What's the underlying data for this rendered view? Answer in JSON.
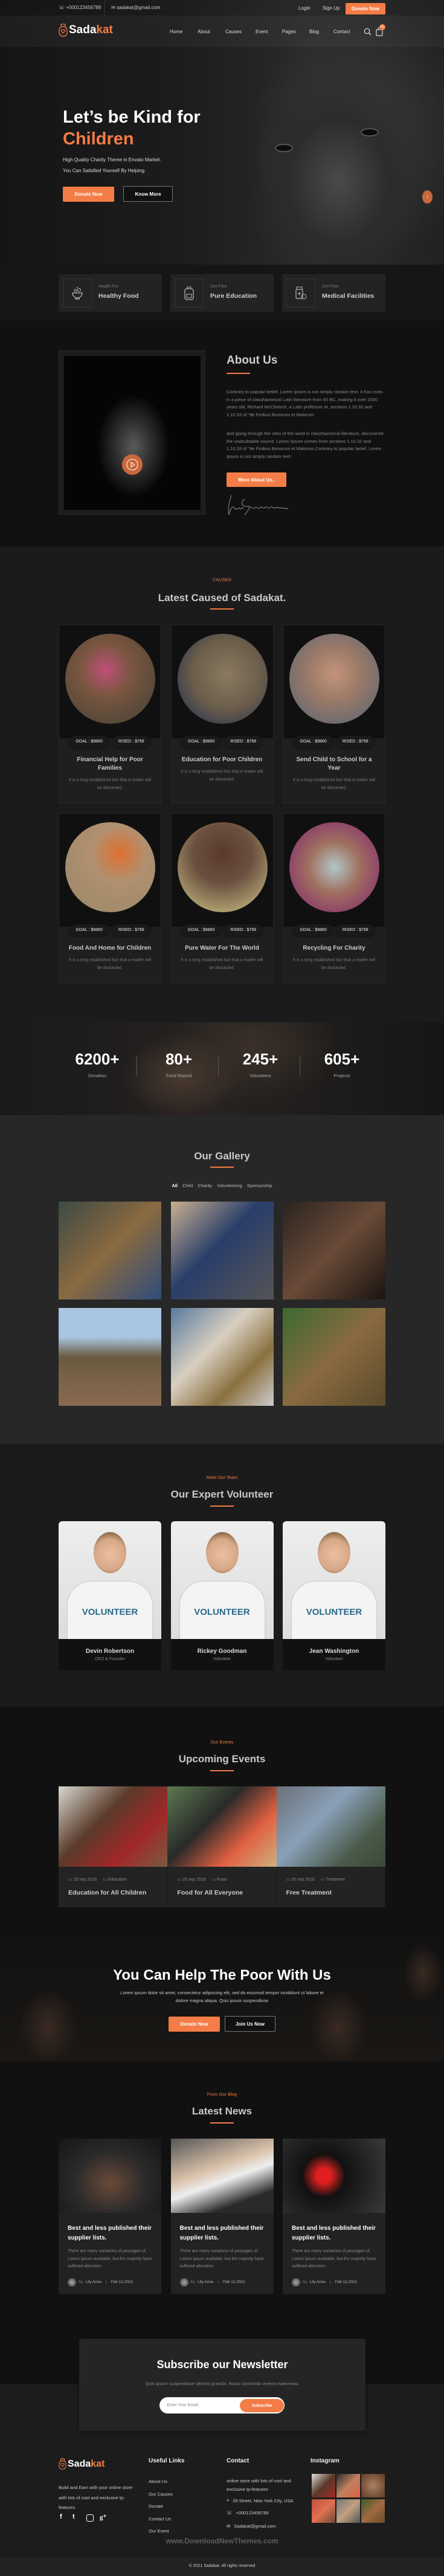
{
  "topbar": {
    "phone": "+000123456789",
    "email": "sadakat@gmail.com",
    "login": "Login",
    "signup": "Sign Up",
    "donate": "Donate Now"
  },
  "brand": {
    "part1": "Sada",
    "part2": "kat",
    "accent": "#f47c46"
  },
  "nav": {
    "items": [
      {
        "label": "Home"
      },
      {
        "label": "About"
      },
      {
        "label": "Causes"
      },
      {
        "label": "Event"
      },
      {
        "label": "Pages"
      },
      {
        "label": "Blog"
      },
      {
        "label": "Contact"
      }
    ],
    "cart_count": "02"
  },
  "hero": {
    "title_line1": "Let’s be Kind for",
    "title_line2": "Children",
    "sub1": "High Quality Charity Theme in Envato Market.",
    "sub2": "You Can Satisfied Yourself By Helping.",
    "donate": "Donate Now",
    "know_more": "Know More"
  },
  "features": [
    {
      "small": "Health For",
      "big": "Healthy Food",
      "icon": "food-bowl-icon"
    },
    {
      "small": "Get Free",
      "big": "Pure Education",
      "icon": "backpack-icon"
    },
    {
      "small": "Get Free",
      "big": "Medical Facilities",
      "icon": "medicine-icon"
    }
  ],
  "about": {
    "title": "About Us",
    "para1": "Contrary to popular belief, Lorem Ipsum is not simply random text. It has roots in a piece of classNameical Latin literature from 45 BC, making it over 2000 years old. Richard McClintock, a Latin professor at ,sections 1.10.32 and 1.10.33 of \"de Finibus Bonorum et Malorum",
    "para2": "and going through the cites of the word in classNameical literature, discovered the undoubtable source. Lorem Ipsum comes from sections 1.10.32 and 1.10.33 of \"de Finibus Bonorum et Malorum,Contrary to popular belief, Lorem Ipsum is not simply random text.",
    "button": "More About Us..",
    "signature": "Frank Sinatra"
  },
  "causes": {
    "kicker": "CAUSES",
    "title": "Latest Caused of Sadakat.",
    "items": [
      {
        "goal": "GOAL : $9860",
        "raised": "RISED : $768",
        "title": "Financial Help for Poor Families",
        "text": "It is a long established fact that a reader will be distracted."
      },
      {
        "goal": "GOAL : $9860",
        "raised": "RISED : $768",
        "title": "Education for Poor Children",
        "text": "It is a long established fact that a reader will be distracted."
      },
      {
        "goal": "GOAL : $9860",
        "raised": "RISED : $768",
        "title": "Send Child to School for a Year",
        "text": "It is a long established fact that a reader will be distracted."
      },
      {
        "goal": "GOAL : $9860",
        "raised": "RISED : $768",
        "title": "Food And Home for Children",
        "text": "It is a long established fact that a reader will be distracted."
      },
      {
        "goal": "GOAL : $9860",
        "raised": "RISED : $768",
        "title": "Pure Water For The World",
        "text": "It is a long established fact that a reader will be distracted."
      },
      {
        "goal": "GOAL : $9860",
        "raised": "RISED : $768",
        "title": "Recycling For Charity",
        "text": "It is a long established fact that a reader will be distracted."
      }
    ]
  },
  "stats": [
    {
      "value": "6200+",
      "label": "Donation"
    },
    {
      "value": "80+",
      "label": "Fund Raised"
    },
    {
      "value": "245+",
      "label": "Volunteers"
    },
    {
      "value": "605+",
      "label": "Projects"
    }
  ],
  "gallery": {
    "title": "Our Gallery",
    "filters": [
      {
        "label": "All"
      },
      {
        "label": "Child"
      },
      {
        "label": "Charity"
      },
      {
        "label": "Volunteering"
      },
      {
        "label": "Sponsorship"
      }
    ],
    "active_filter": "All",
    "images": [
      {},
      {},
      {},
      {},
      {},
      {}
    ]
  },
  "team": {
    "kicker": "Meet Our Team",
    "title": "Our Expert Volunteer",
    "members": [
      {
        "name": "Devin Robertson",
        "role": "CEO & Founder",
        "shirt": "VOLUNTEER"
      },
      {
        "name": "Rickey Goodman",
        "role": "Volunteer",
        "shirt": "VOLUNTEER"
      },
      {
        "name": "Jean Washington",
        "role": "Volunteer",
        "shirt": "VOLUNTEER"
      }
    ]
  },
  "events": {
    "kicker": "Our Events",
    "title": "Upcoming Events",
    "items": [
      {
        "date": "20 sep 2018",
        "category": "Education",
        "title": "Education for All Children"
      },
      {
        "date": "20 sep 2018",
        "category": "Food",
        "title": "Food for All Everyone"
      },
      {
        "date": "20 sep 2018",
        "category": "Treatment",
        "title": "Free Treatment"
      }
    ]
  },
  "cta": {
    "title": "You Can Help The Poor With Us",
    "text": "Lorem ipsum dolor sit amet, consectetur adipiscing elit, sed do eiusmod tempor incididunt ut labore et dolore magna aliqua. Quis ipsum suspendisse",
    "donate": "Donate Now",
    "join": "Join Us Now"
  },
  "blog": {
    "kicker": "From Our Blog",
    "title": "Latest News",
    "posts": [
      {
        "title": "Best and less published their supplier lists.",
        "text": "There are many variations of passages of Lorem Ipsum available, but the majority have suffered alteration.",
        "by": "By",
        "author": "Lily Anne",
        "date": "Feb 12,2021"
      },
      {
        "title": "Best and less published their supplier lists.",
        "text": "There are many variations of passages of Lorem Ipsum available, but the majority have suffered alteration.",
        "by": "By",
        "author": "Lily Anne",
        "date": "Feb 12,2021"
      },
      {
        "title": "Best and less published their supplier lists.",
        "text": "There are many variations of passages of Lorem Ipsum available, but the majority have suffered alteration.",
        "by": "By",
        "author": "Lily Anne",
        "date": "Feb 12,2021"
      }
    ]
  },
  "newsletter": {
    "title": "Subscribe our Newsletter",
    "text": "Quis ipsum suspendisse ultrices gravida. Risus commodo viverra maecenas.",
    "placeholder": "Enter Your Email",
    "button": "Subscribe"
  },
  "footer": {
    "about": "Build and Earn with your online store with lots of cool and exclusive tp-features",
    "useful_title": "Useful Links",
    "links": [
      {
        "label": "About Us"
      },
      {
        "label": "Our Causes"
      },
      {
        "label": "Donate"
      },
      {
        "label": "Contact Us"
      },
      {
        "label": "Our Event"
      }
    ],
    "contact_title": "Contact",
    "contact_text": "online store with lots of cool and exclusive tp-features",
    "address": "28 Street, New York City, USA",
    "phone": "+000123456789",
    "email": "Sadakat@gmail.com",
    "instagram_title": "Instagram",
    "instagram": [
      {},
      {},
      {},
      {},
      {},
      {}
    ],
    "watermark": "www.DownloadNewThemes.com",
    "copyright": "© 2021 Sadakat. All rights reserved"
  }
}
